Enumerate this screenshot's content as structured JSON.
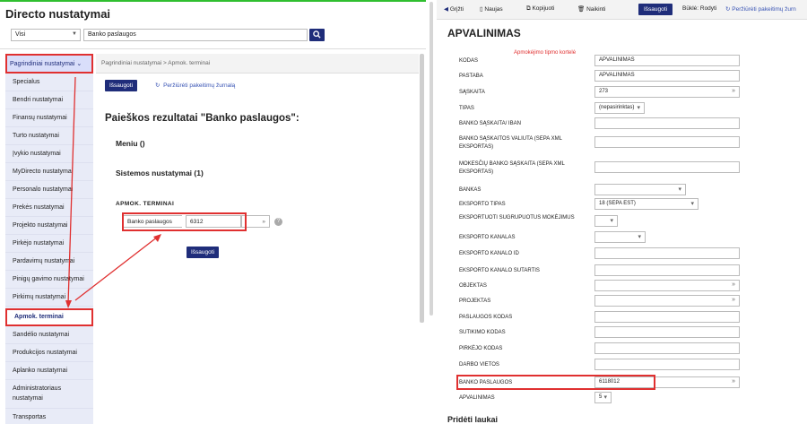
{
  "left": {
    "app_title": "Directo nustatymai",
    "filter_select": "Visi",
    "search_value": "Banko paslaugos",
    "search_icon": "search-icon",
    "sidebar": {
      "header": "Pagrindiniai nustatymai",
      "items": [
        "Specialus",
        "Bendri nustatymai",
        "Finansų nustatymai",
        "Turto nustatymai",
        "Įvykio nustatymai",
        "MyDirecto nustatymai",
        "Personalo nustatymai",
        "Prekės nustatymai",
        "Projekto nustatymai",
        "Pirkėjo nustatymai",
        "Pardavimų nustatymai",
        "Pinigų gavimo nustatymai",
        "Pirkimų nustatymai",
        "Apmok. terminai",
        "Sandėlio nustatymai",
        "Produkcijos nustatymai",
        "Aplanko nustatymai",
        "Administratoriaus nustatymai",
        "Transportas"
      ]
    },
    "breadcrumb": "Pagrindiniai nustatymai > Apmok. terminai",
    "save_label": "Išsaugoti",
    "history_label": "Peržiūrėti pakeitimų žurnalą",
    "results_title": "Paieškos rezultatai \"Banko paslaugos\":",
    "menu_heading": "Meniu ()",
    "system_heading": "Sistemos nustatymai (1)",
    "section_heading": "APMOK. TERMINAI",
    "field_label": "Banko paslaugos",
    "field_value": "6312",
    "field_chevron": "»",
    "help_glyph": "?",
    "save_bottom_label": "Išsaugoti"
  },
  "right": {
    "toolbar": {
      "grizti": "Grįžti",
      "naujas": "Naujas",
      "kopijuoti": "Kopijuoti",
      "naikinti": "Naikinti",
      "issaugoti": "Išsaugoti",
      "status": "Būklė: Rodyti",
      "history": "Peržiūrėti pakeitimų žurn"
    },
    "title": "APVALINIMAS",
    "note": "Apmokėjimo tipmo kortelė",
    "fields": [
      {
        "label": "KODAS",
        "value": "APVALINIMAS",
        "kind": "text"
      },
      {
        "label": "PASTABA",
        "value": "APVALINIMAS",
        "kind": "text"
      },
      {
        "label": "SĄSKAITA",
        "value": "273",
        "kind": "chev"
      },
      {
        "label": "TIPAS",
        "value": "(nepasirinktas)",
        "kind": "select"
      },
      {
        "label": "BANKO SĄSKAITA/ IBAN",
        "value": "",
        "kind": "text"
      },
      {
        "label": "BANKO SĄSKAITOS VALIUTA (SEPA XML EKSPORTAS)",
        "value": "",
        "kind": "text"
      },
      {
        "label": "MOKESČIŲ BANKO SĄSKAITA (SEPA XML EKSPORTAS)",
        "value": "",
        "kind": "text"
      },
      {
        "label": "BANKAS",
        "value": "",
        "kind": "select"
      },
      {
        "label": "EKSPORTO TIPAS",
        "value": "18 (SEPA EST)",
        "kind": "select"
      },
      {
        "label": "EKSPORTUOTI SUGRUPUOTUS MOKĖJIMUS",
        "value": "",
        "kind": "select"
      },
      {
        "label": "EKSPORTO KANALAS",
        "value": "",
        "kind": "select"
      },
      {
        "label": "EKSPORTO KANALO ID",
        "value": "",
        "kind": "text"
      },
      {
        "label": "EKSPORTO KANALO SUTARTIS",
        "value": "",
        "kind": "text"
      },
      {
        "label": "OBJEKTAS",
        "value": "",
        "kind": "chev"
      },
      {
        "label": "PROJEKTAS",
        "value": "",
        "kind": "chev"
      },
      {
        "label": "PASLAUGOS KODAS",
        "value": "",
        "kind": "text"
      },
      {
        "label": "SUTIKIMO KODAS",
        "value": "",
        "kind": "text"
      },
      {
        "label": "PIRKĖJO KODAS",
        "value": "",
        "kind": "text"
      },
      {
        "label": "DARBO VIETOS",
        "value": "",
        "kind": "text"
      },
      {
        "label": "BANKO PASLAUGOS",
        "value": "6118012",
        "kind": "chev"
      },
      {
        "label": "APVALINIMAS",
        "value": "5",
        "kind": "select"
      }
    ],
    "bottom_heading": "Pridėti laukai"
  },
  "colors": {
    "accent": "#1f2d7a",
    "highlight": "#e03030",
    "sidebar_bg": "#e8ebf7",
    "top_border": "#2fbf2f"
  }
}
